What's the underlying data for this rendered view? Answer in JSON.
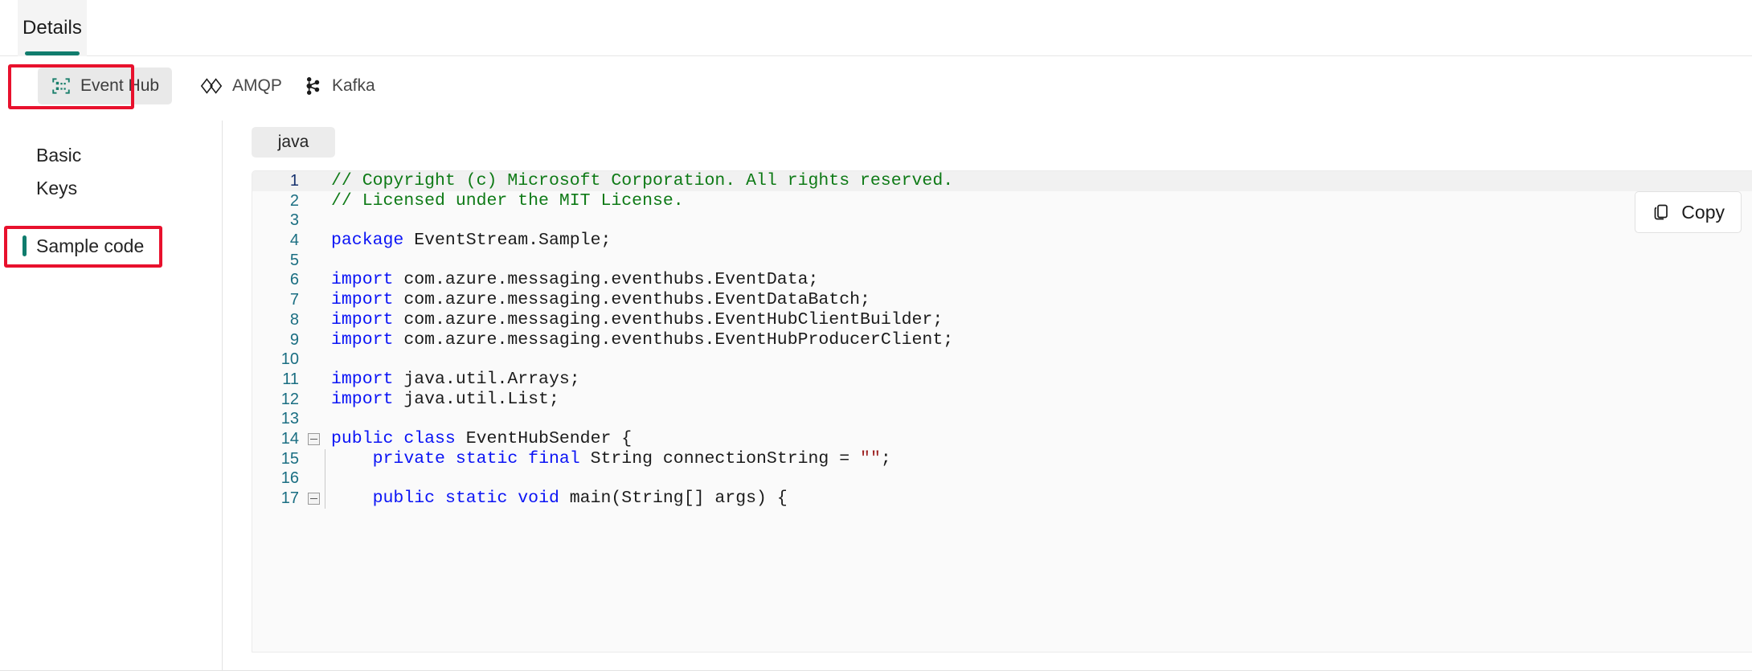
{
  "window": {
    "tab": {
      "label": "Details",
      "accent_color": "#107c6d"
    }
  },
  "protocols": [
    {
      "name": "Event Hub",
      "icon": "event-hub-icon",
      "selected": true,
      "icon_color": "#1a7f6b"
    },
    {
      "name": "AMQP",
      "icon": "amqp-icon",
      "selected": false,
      "icon_color": "#1b1b1b"
    },
    {
      "name": "Kafka",
      "icon": "kafka-icon",
      "selected": false,
      "icon_color": "#1b1b1b"
    }
  ],
  "sidebar": {
    "items": [
      {
        "label": "Basic",
        "selected": false
      },
      {
        "label": "Keys",
        "selected": false
      },
      {
        "label": "Sample code",
        "selected": true
      }
    ]
  },
  "code_panel": {
    "language_pill": "java",
    "copy_button": "Copy",
    "copy_icon": "copy-icon",
    "lines": [
      {
        "n": "1",
        "fold": false,
        "indent": false,
        "highlight": true,
        "tokens": [
          {
            "t": "// Copyright (c) Microsoft Corporation. All rights reserved.",
            "c": "cm"
          }
        ]
      },
      {
        "n": "2",
        "fold": false,
        "indent": false,
        "highlight": false,
        "tokens": [
          {
            "t": "// Licensed under the MIT License.",
            "c": "cm"
          }
        ]
      },
      {
        "n": "3",
        "fold": false,
        "indent": false,
        "highlight": false,
        "tokens": []
      },
      {
        "n": "4",
        "fold": false,
        "indent": false,
        "highlight": false,
        "tokens": [
          {
            "t": "package",
            "c": "k"
          },
          {
            "t": " EventStream.Sample;",
            "c": "pl"
          }
        ]
      },
      {
        "n": "5",
        "fold": false,
        "indent": false,
        "highlight": false,
        "tokens": []
      },
      {
        "n": "6",
        "fold": false,
        "indent": false,
        "highlight": false,
        "tokens": [
          {
            "t": "import",
            "c": "k"
          },
          {
            "t": " com.azure.messaging.eventhubs.EventData;",
            "c": "pl"
          }
        ]
      },
      {
        "n": "7",
        "fold": false,
        "indent": false,
        "highlight": false,
        "tokens": [
          {
            "t": "import",
            "c": "k"
          },
          {
            "t": " com.azure.messaging.eventhubs.EventDataBatch;",
            "c": "pl"
          }
        ]
      },
      {
        "n": "8",
        "fold": false,
        "indent": false,
        "highlight": false,
        "tokens": [
          {
            "t": "import",
            "c": "k"
          },
          {
            "t": " com.azure.messaging.eventhubs.EventHubClientBuilder;",
            "c": "pl"
          }
        ]
      },
      {
        "n": "9",
        "fold": false,
        "indent": false,
        "highlight": false,
        "tokens": [
          {
            "t": "import",
            "c": "k"
          },
          {
            "t": " com.azure.messaging.eventhubs.EventHubProducerClient;",
            "c": "pl"
          }
        ]
      },
      {
        "n": "10",
        "fold": false,
        "indent": false,
        "highlight": false,
        "tokens": []
      },
      {
        "n": "11",
        "fold": false,
        "indent": false,
        "highlight": false,
        "tokens": [
          {
            "t": "import",
            "c": "k"
          },
          {
            "t": " java.util.Arrays;",
            "c": "pl"
          }
        ]
      },
      {
        "n": "12",
        "fold": false,
        "indent": false,
        "highlight": false,
        "tokens": [
          {
            "t": "import",
            "c": "k"
          },
          {
            "t": " java.util.List;",
            "c": "pl"
          }
        ]
      },
      {
        "n": "13",
        "fold": false,
        "indent": false,
        "highlight": false,
        "tokens": []
      },
      {
        "n": "14",
        "fold": true,
        "indent": false,
        "highlight": false,
        "tokens": [
          {
            "t": "public",
            "c": "k"
          },
          {
            "t": " ",
            "c": "pl"
          },
          {
            "t": "class",
            "c": "k"
          },
          {
            "t": " EventHubSender {",
            "c": "pl"
          }
        ]
      },
      {
        "n": "15",
        "fold": false,
        "indent": true,
        "highlight": false,
        "tokens": [
          {
            "t": "    ",
            "c": "pl"
          },
          {
            "t": "private",
            "c": "k"
          },
          {
            "t": " ",
            "c": "pl"
          },
          {
            "t": "static",
            "c": "k"
          },
          {
            "t": " ",
            "c": "pl"
          },
          {
            "t": "final",
            "c": "k"
          },
          {
            "t": " String connectionString = ",
            "c": "pl"
          },
          {
            "t": "\"\"",
            "c": "st"
          },
          {
            "t": ";",
            "c": "pl"
          }
        ]
      },
      {
        "n": "16",
        "fold": false,
        "indent": true,
        "highlight": false,
        "tokens": []
      },
      {
        "n": "17",
        "fold": true,
        "indent": true,
        "highlight": false,
        "tokens": [
          {
            "t": "    ",
            "c": "pl"
          },
          {
            "t": "public",
            "c": "k"
          },
          {
            "t": " ",
            "c": "pl"
          },
          {
            "t": "static",
            "c": "k"
          },
          {
            "t": " ",
            "c": "pl"
          },
          {
            "t": "void",
            "c": "k"
          },
          {
            "t": " main(String[] args) {",
            "c": "pl"
          }
        ]
      }
    ]
  },
  "annotations": [
    {
      "name": "event-hub-highlight",
      "color": "#e8112d"
    },
    {
      "name": "sample-code-highlight",
      "color": "#e8112d"
    }
  ]
}
